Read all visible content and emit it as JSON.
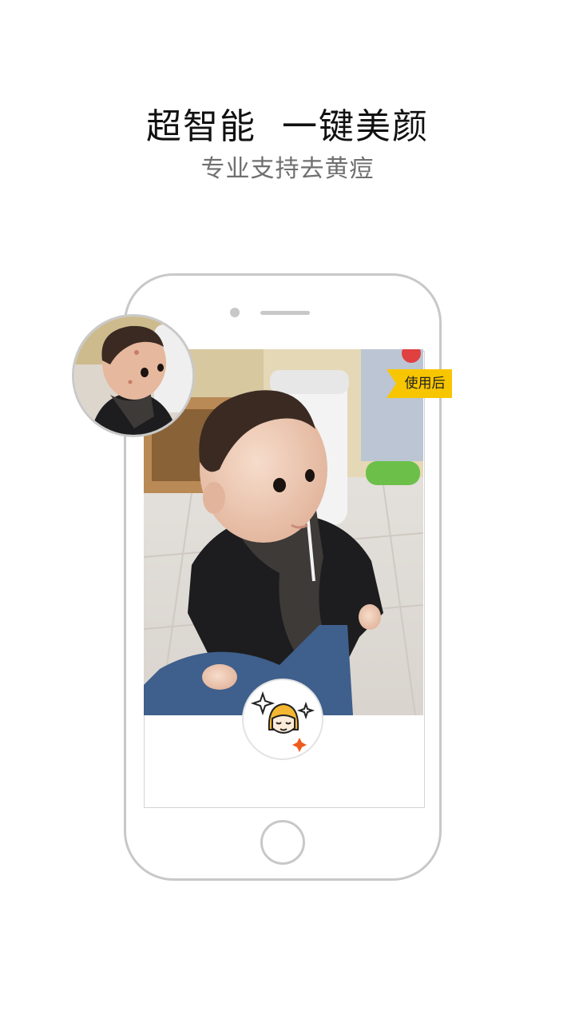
{
  "headline": "超智能  一键美颜",
  "subline": "专业支持去黄痘",
  "after_tag": "使用后",
  "colors": {
    "tag_yellow": "#f7c600",
    "frame_gray": "#c8c8c8",
    "accent_orange": "#f05a1a"
  },
  "icons": {
    "beauty_button": "smiling-face-sparkles-icon"
  }
}
